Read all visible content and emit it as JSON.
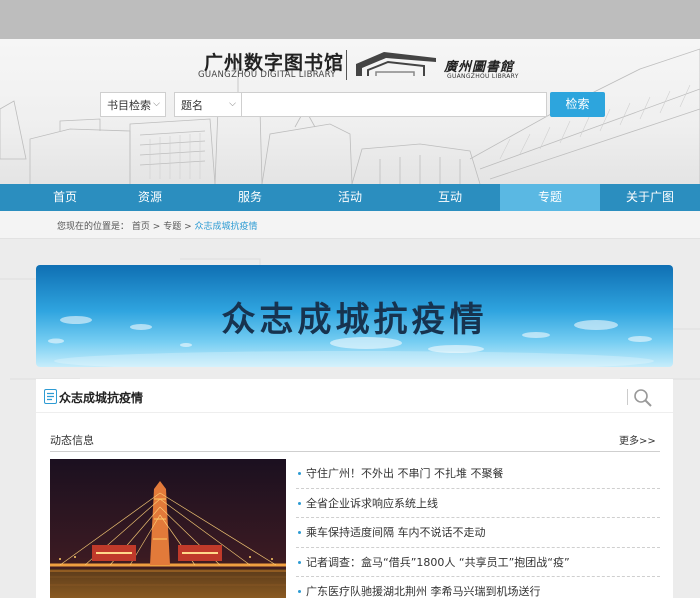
{
  "header": {
    "logo_cn": "广州数字图书馆",
    "logo_en": "GUANGZHOU DIGITAL LIBRARY",
    "library_cn": "廣州圖書館",
    "library_en": "GUANGZHOU LIBRARY"
  },
  "search": {
    "category_select": "书目检索",
    "field_select": "题名",
    "query_value": "",
    "button_label": "检索"
  },
  "nav": {
    "items": [
      "首页",
      "资源",
      "服务",
      "活动",
      "互动",
      "专题",
      "关于广图"
    ],
    "active_index": 5
  },
  "breadcrumb": {
    "prefix": "您现在的位置是：",
    "home": "首页",
    "sep1": " > ",
    "section": "专题",
    "sep2": " > ",
    "current": "众志成城抗疫情"
  },
  "banner": {
    "title": "众志成城抗疫情"
  },
  "panel": {
    "title": "众志成城抗疫情",
    "news_label": "动态信息",
    "more_label": "更多>>",
    "news": [
      "守住广州！不外出 不串门 不扎堆 不聚餐",
      "全省企业诉求响应系统上线",
      "乘车保持适度间隔 车内不说话不走动",
      "记者调查：盒马“借兵”1800人 “共享员工”抱团战“疫”",
      "广东医疗队驰援湖北荆州 李希马兴瑞到机场送行"
    ]
  },
  "colors": {
    "nav_bg": "#2b8ebf",
    "nav_active": "#5ab8e3",
    "search_button": "#2da5dd",
    "link_accent": "#2d9bd3"
  },
  "icons": {
    "panel_title": "document-icon",
    "panel_search": "search-icon",
    "list_bullet": "dot-bullet"
  }
}
